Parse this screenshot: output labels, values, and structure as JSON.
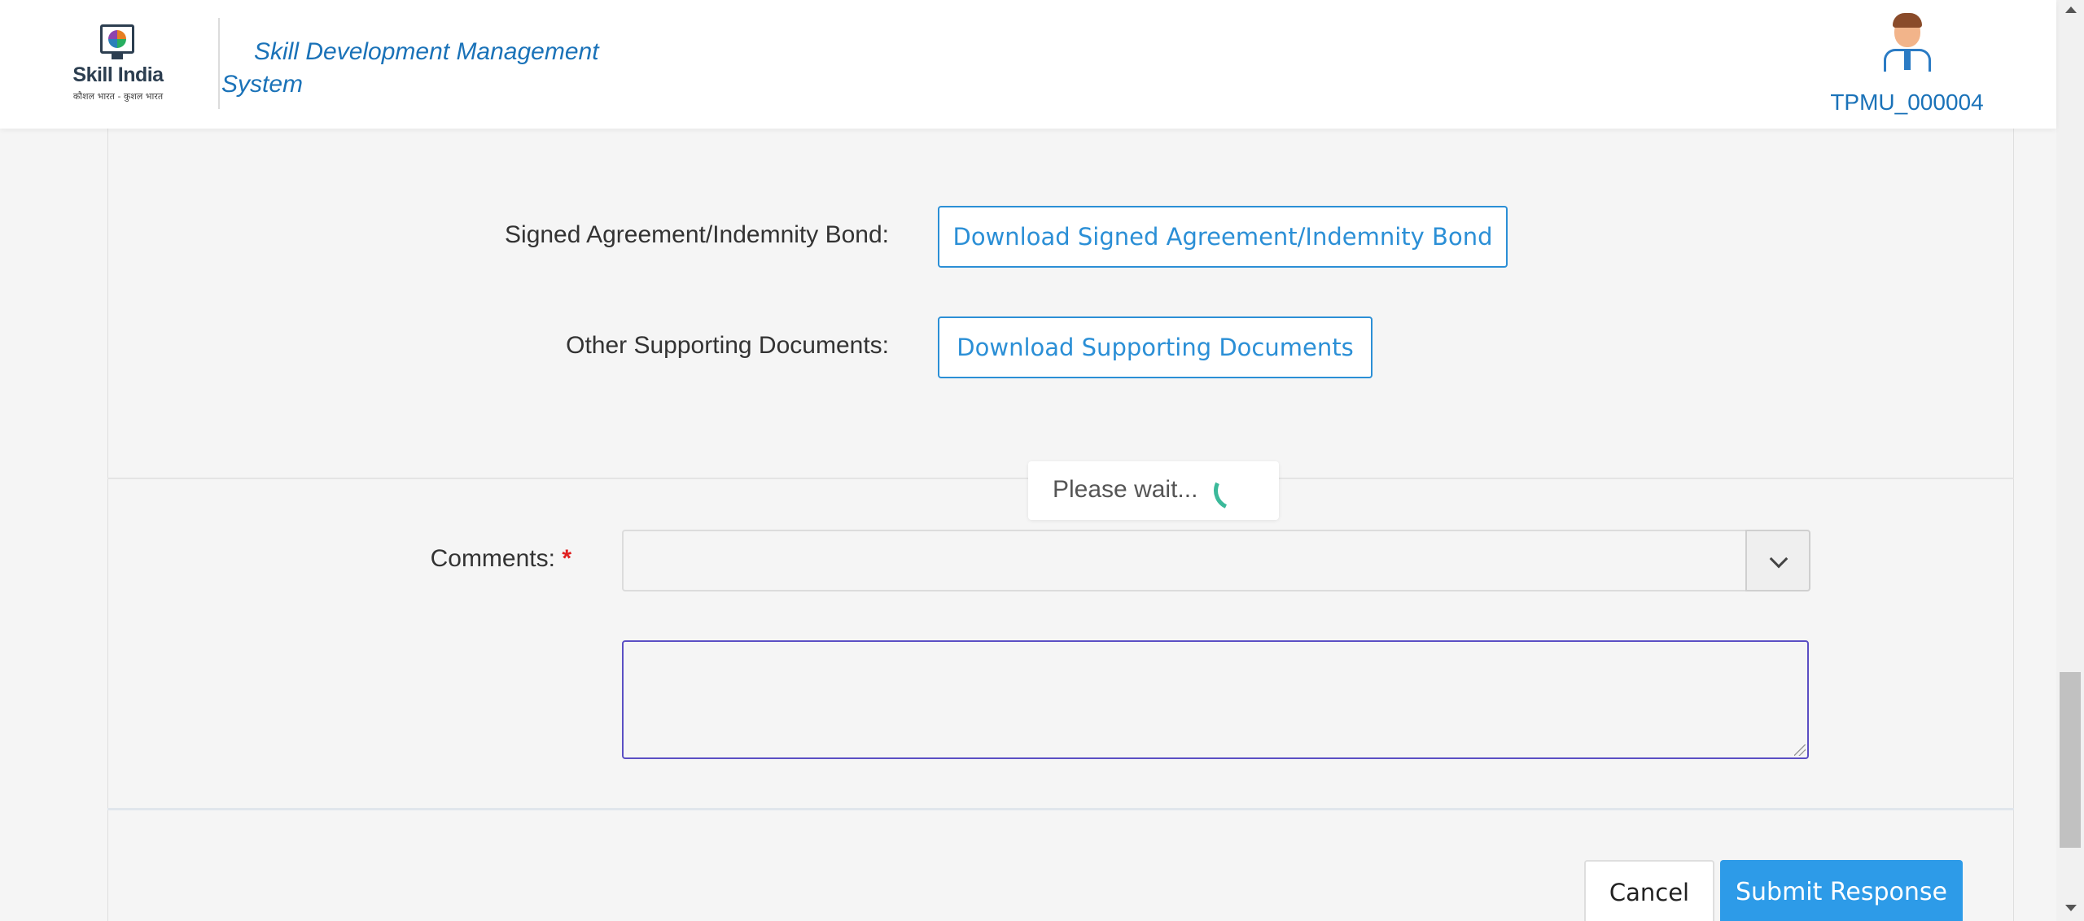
{
  "header": {
    "logo_text": "Skill India",
    "logo_tagline": "कौशल भारत - कुशल भारत",
    "app_title": "Skill Development Management System",
    "user_id": "TPMU_000004"
  },
  "documents": {
    "signed_agreement_label": "Signed Agreement/Indemnity Bond:",
    "signed_agreement_button": "Download Signed Agreement/Indemnity Bond",
    "supporting_docs_label": "Other Supporting Documents:",
    "supporting_docs_button": "Download Supporting Documents"
  },
  "comments": {
    "label": "Comments:",
    "required_mark": "*",
    "select_value": "",
    "textarea_value": ""
  },
  "loader": {
    "text": "Please wait..."
  },
  "actions": {
    "cancel_label": "Cancel",
    "submit_label": "Submit Response"
  },
  "colors": {
    "accent": "#2d9be8",
    "link": "#1a72b8",
    "required": "#e02020",
    "spinner": "#3bb99a"
  }
}
